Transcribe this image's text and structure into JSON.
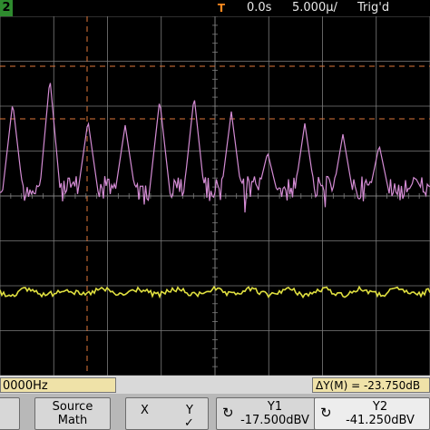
{
  "channel_badge": "2",
  "trigger_marker": "T",
  "top": {
    "time": "0.0s",
    "timebase": "5.000µ/",
    "trig_status": "Trig'd"
  },
  "colors": {
    "grid": "#7d7d7d",
    "math_trace": "#d48cd4",
    "channel_trace": "#e0e040",
    "cursor": "#e0783a",
    "badge": "#2e8b2e"
  },
  "status": {
    "left": "0000Hz",
    "right": "ΔY(M) = -23.750dB"
  },
  "softkeys": {
    "source_l1": "Source",
    "source_l2": "Math",
    "x_label": "X",
    "y_label": "Y",
    "y_check": "✓",
    "y1_l1": "Y1",
    "y1_l2": "-17.500dBV",
    "y2_l1": "Y2",
    "y2_l2": "-41.250dBV",
    "cycle_icon": "↻"
  }
}
